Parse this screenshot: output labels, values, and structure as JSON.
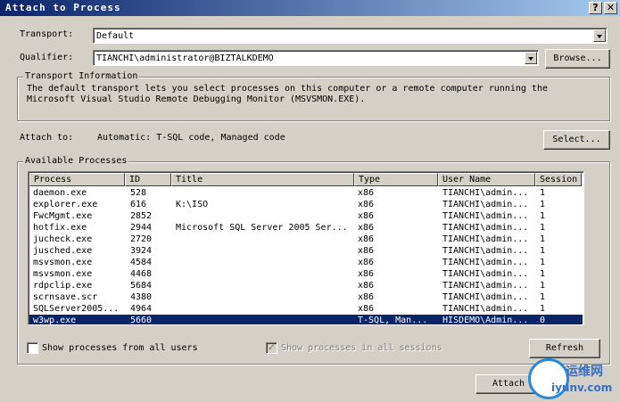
{
  "window": {
    "title": "Attach to Process",
    "help_glyph": "?",
    "close_glyph": "✕"
  },
  "transport": {
    "label": "Transport:",
    "value": "Default"
  },
  "qualifier": {
    "label": "Qualifier:",
    "value": "TIANCHI\\administrator@BIZTALKDEMO",
    "browse_label": "Browse..."
  },
  "transport_info": {
    "title": "Transport Information",
    "line1": "The default transport lets you select processes on this computer or a remote computer running the",
    "line2": "Microsoft Visual Studio Remote Debugging Monitor (MSVSMON.EXE)."
  },
  "attach_to": {
    "label": "Attach to:",
    "value": "Automatic: T-SQL code, Managed code",
    "select_label": "Select..."
  },
  "available": {
    "title": "Available Processes",
    "columns": [
      "Process",
      "ID",
      "Title",
      "Type",
      "User Name",
      "Session"
    ],
    "rows": [
      {
        "process": "daemon.exe",
        "id": "528",
        "title": "",
        "type": "x86",
        "user": "TIANCHI\\admin...",
        "session": "1"
      },
      {
        "process": "explorer.exe",
        "id": "616",
        "title": "K:\\ISO",
        "type": "x86",
        "user": "TIANCHI\\admin...",
        "session": "1"
      },
      {
        "process": "FwcMgmt.exe",
        "id": "2852",
        "title": "",
        "type": "x86",
        "user": "TIANCHI\\admin...",
        "session": "1"
      },
      {
        "process": "hotfix.exe",
        "id": "2944",
        "title": "Microsoft SQL Server 2005 Ser...",
        "type": "x86",
        "user": "TIANCHI\\admin...",
        "session": "1"
      },
      {
        "process": "jucheck.exe",
        "id": "2720",
        "title": "",
        "type": "x86",
        "user": "TIANCHI\\admin...",
        "session": "1"
      },
      {
        "process": "jusched.exe",
        "id": "3924",
        "title": "",
        "type": "x86",
        "user": "TIANCHI\\admin...",
        "session": "1"
      },
      {
        "process": "msvsmon.exe",
        "id": "4584",
        "title": "",
        "type": "x86",
        "user": "TIANCHI\\admin...",
        "session": "1"
      },
      {
        "process": "msvsmon.exe",
        "id": "4468",
        "title": "",
        "type": "x86",
        "user": "TIANCHI\\admin...",
        "session": "1"
      },
      {
        "process": "rdpclip.exe",
        "id": "5684",
        "title": "",
        "type": "x86",
        "user": "TIANCHI\\admin...",
        "session": "1"
      },
      {
        "process": "scrnsave.scr",
        "id": "4380",
        "title": "",
        "type": "x86",
        "user": "TIANCHI\\admin...",
        "session": "1"
      },
      {
        "process": "SQLServer2005...",
        "id": "4964",
        "title": "",
        "type": "x86",
        "user": "TIANCHI\\admin...",
        "session": "1"
      },
      {
        "process": "w3wp.exe",
        "id": "5660",
        "title": "",
        "type": "T-SQL, Man...",
        "user": "HISDEMO\\Admin...",
        "session": "0",
        "selected": true
      }
    ],
    "show_all_users_label": "Show processes from all users",
    "show_all_sessions_label": "Show processes in all sessions",
    "refresh_label": "Refresh"
  },
  "attach_button_label": "Attach",
  "watermark": {
    "cn": "运维网",
    "url": "iyunv.com"
  },
  "colors": {
    "selection": "#0a246a",
    "face": "#d4d0c8",
    "titlebar": "#0a246a"
  }
}
